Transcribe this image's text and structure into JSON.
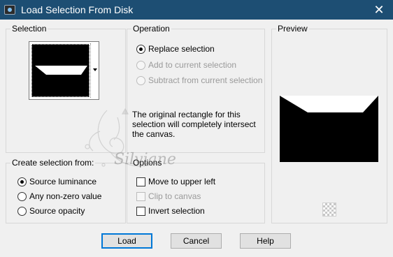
{
  "window": {
    "title": "Load Selection From Disk",
    "close_glyph": "✕",
    "app_icon": "paint-shop-app-icon"
  },
  "selection_group": {
    "title": "Selection"
  },
  "operation_group": {
    "title": "Operation",
    "options": [
      {
        "label": "Replace selection",
        "checked": true,
        "enabled": true
      },
      {
        "label": "Add to current selection",
        "checked": false,
        "enabled": false
      },
      {
        "label": "Subtract from current selection",
        "checked": false,
        "enabled": false
      }
    ],
    "info_text": "The original rectangle for this selection will completely intersect the canvas."
  },
  "preview_group": {
    "title": "Preview"
  },
  "create_group": {
    "title": "Create selection from:",
    "options": [
      {
        "label": "Source luminance",
        "checked": true
      },
      {
        "label": "Any non-zero value",
        "checked": false
      },
      {
        "label": "Source opacity",
        "checked": false
      }
    ]
  },
  "options_group": {
    "title": "Options",
    "options": [
      {
        "label": "Move to upper left",
        "checked": false,
        "enabled": true
      },
      {
        "label": "Clip to canvas",
        "checked": false,
        "enabled": false
      },
      {
        "label": "Invert selection",
        "checked": false,
        "enabled": true
      }
    ]
  },
  "buttons": {
    "load": "Load",
    "cancel": "Cancel",
    "help": "Help"
  },
  "watermark": "Silviane",
  "colors": {
    "titlebar": "#1d4e73",
    "dialog_bg": "#f0f0f0",
    "default_button_border": "#0078d7"
  }
}
